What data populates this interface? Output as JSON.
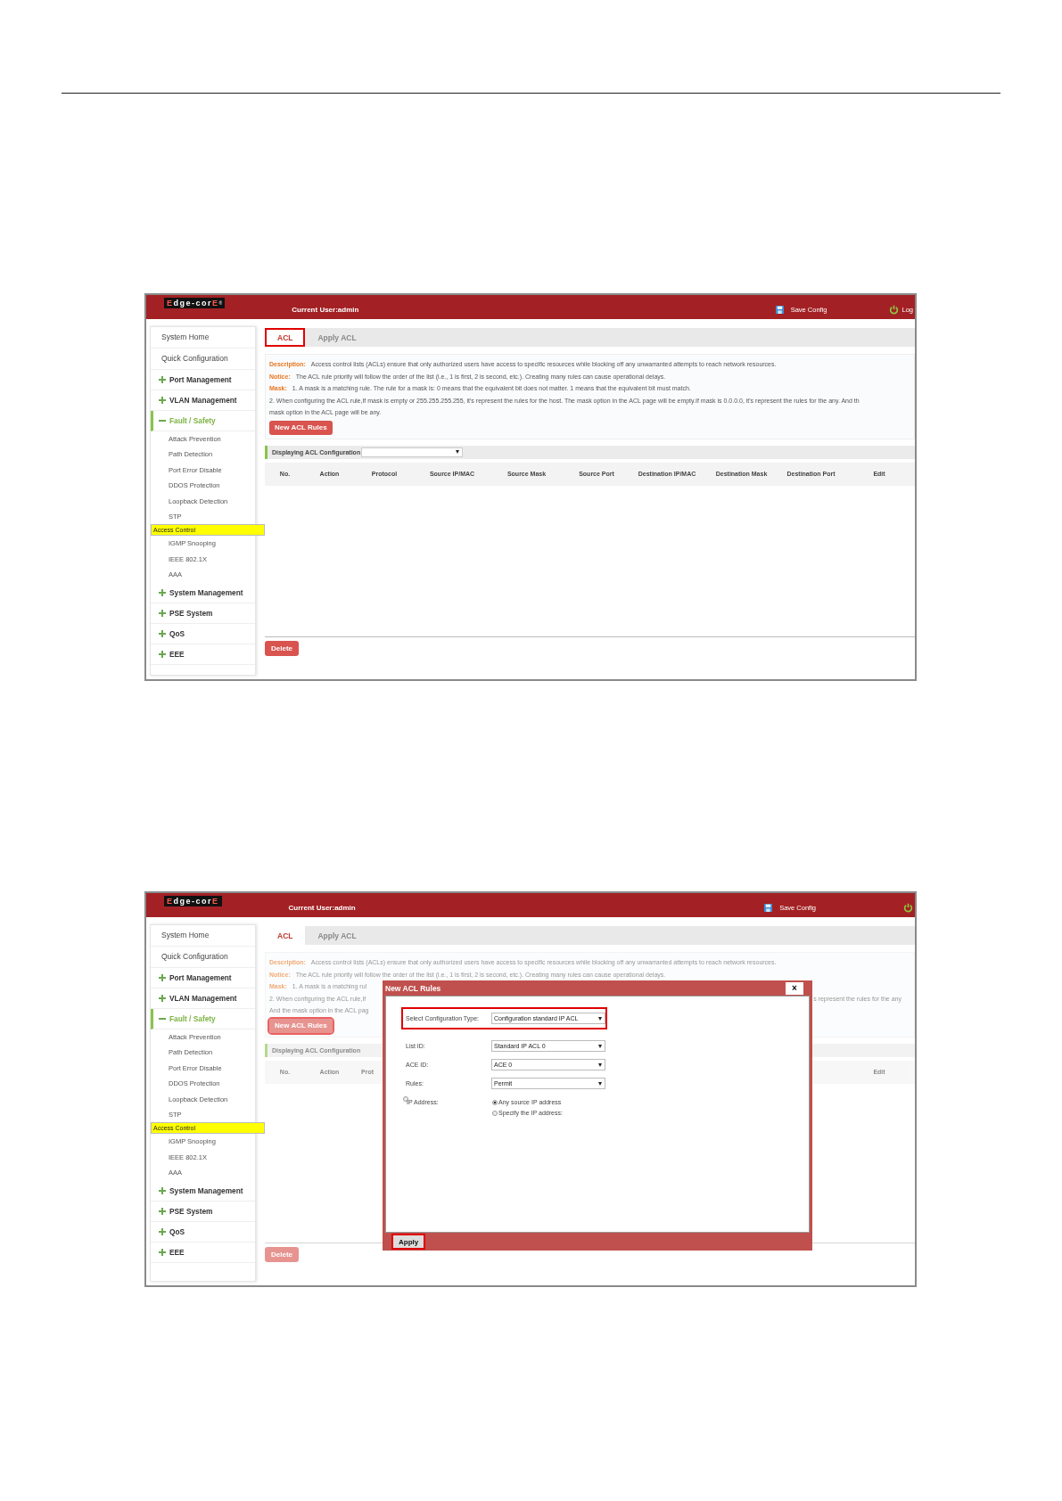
{
  "screens": [
    {
      "kind": "list",
      "header": {
        "logo": "Edge-corE",
        "logo_mark": "®",
        "user": "Current User:admin",
        "save": "Save Config",
        "logout": "Log"
      },
      "sidebar": [
        {
          "kind": "page",
          "label": "System Home"
        },
        {
          "kind": "page",
          "label": "Quick Configuration"
        },
        {
          "kind": "group",
          "label": "Port Management",
          "expanded": false
        },
        {
          "kind": "group",
          "label": "VLAN Management",
          "expanded": false
        },
        {
          "kind": "group",
          "label": "Fault / Safety",
          "expanded": true,
          "children": [
            {
              "label": "Attack Prevention",
              "selected": false
            },
            {
              "label": "Path Detection",
              "selected": false
            },
            {
              "label": "Port Error Disable",
              "selected": false
            },
            {
              "label": "DDOS Protection",
              "selected": false
            },
            {
              "label": "Loopback Detection",
              "selected": false
            },
            {
              "label": "STP",
              "selected": false
            },
            {
              "label": "Access Control",
              "selected": true
            },
            {
              "label": "IGMP Snooping",
              "selected": false
            },
            {
              "label": "IEEE 802.1X",
              "selected": false
            },
            {
              "label": "AAA",
              "selected": false
            }
          ]
        },
        {
          "kind": "group",
          "label": "System Management",
          "expanded": false
        },
        {
          "kind": "group",
          "label": "PSE System",
          "expanded": false
        },
        {
          "kind": "group",
          "label": "QoS",
          "expanded": false
        },
        {
          "kind": "group",
          "label": "EEE",
          "expanded": false
        }
      ],
      "tabs": [
        {
          "label": "ACL",
          "selected": true,
          "highlighted": true
        },
        {
          "label": "Apply ACL",
          "selected": false,
          "highlighted": false
        }
      ],
      "info": [
        {
          "label": "Description:",
          "text": "Access control lists (ACLs) ensure that only authorized users have access to specific resources while blocking off any unwarranted attempts to reach network resources."
        },
        {
          "label": "Notice:",
          "text": "The ACL rule priority will follow the order of the list (i.e., 1 is first, 2 is second, etc.). Creating many rules can cause operational delays."
        },
        {
          "label": "Mask:",
          "text": "1. A mask is a matching rule. The rule for a mask is: 0 means that the equivalent bit does not matter. 1 means that the equivalent bit must match."
        },
        {
          "text": "2. When configuring the ACL rule,If mask is empty or 255.255.255.255, it's represent the rules for the host. The mask option in the ACL page will be empty.If mask is 0.0.0.0, it's represent the rules for the any. And th"
        },
        {
          "text": "mask option in the ACL page will be any."
        }
      ],
      "new_rules": {
        "label": "New ACL Rules",
        "highlighted": false
      },
      "display": {
        "label": "Displaying ACL Configuration",
        "dropdown": true
      },
      "columns": [
        {
          "label": "No."
        },
        {
          "label": "Action"
        },
        {
          "label": "Protocol"
        },
        {
          "label": "Source IP/MAC"
        },
        {
          "label": "Source Mask"
        },
        {
          "label": "Source Port"
        },
        {
          "label": "Destination IP/MAC"
        },
        {
          "label": "Destination Mask"
        },
        {
          "label": "Destination Port"
        },
        {
          "label": "Edit",
          "kind": "edit"
        }
      ],
      "delete": "Delete"
    },
    {
      "kind": "modal",
      "header": {
        "logo": "Edge-corE",
        "user": "Current User:admin",
        "save": "Save Config"
      },
      "sidebar": [
        {
          "kind": "page",
          "label": "System Home"
        },
        {
          "kind": "page",
          "label": "Quick Configuration"
        },
        {
          "kind": "group",
          "label": "Port Management",
          "expanded": false
        },
        {
          "kind": "group",
          "label": "VLAN Management",
          "expanded": false
        },
        {
          "kind": "group",
          "label": "Fault / Safety",
          "expanded": true,
          "children": [
            {
              "label": "Attack Prevention",
              "selected": false
            },
            {
              "label": "Path Detection",
              "selected": false
            },
            {
              "label": "Port Error Disable",
              "selected": false
            },
            {
              "label": "DDOS Protection",
              "selected": false
            },
            {
              "label": "Loopback Detection",
              "selected": false
            },
            {
              "label": "STP",
              "selected": false
            },
            {
              "label": "Access Control",
              "selected": true
            },
            {
              "label": "IGMP Snooping",
              "selected": false
            },
            {
              "label": "IEEE 802.1X",
              "selected": false
            },
            {
              "label": "AAA",
              "selected": false
            }
          ]
        },
        {
          "kind": "group",
          "label": "System Management",
          "expanded": false
        },
        {
          "kind": "group",
          "label": "PSE System",
          "expanded": false
        },
        {
          "kind": "group",
          "label": "QoS",
          "expanded": false
        },
        {
          "kind": "group",
          "label": "EEE",
          "expanded": false
        }
      ],
      "tabs": [
        {
          "label": "ACL",
          "selected": true,
          "highlighted": false
        },
        {
          "label": "Apply ACL",
          "selected": false,
          "highlighted": false
        }
      ],
      "info": [
        {
          "label": "Description:",
          "text": "Access control lists (ACLs) ensure that only authorized users have access to specific resources while blocking off any unwarranted attempts to reach network resources."
        },
        {
          "label": "Notice:",
          "text": "The ACL rule priority will follow the order of the list (i.e., 1 is first, 2 is second, etc.). Creating many rules can cause operational delays."
        },
        {
          "label": "Mask:",
          "text": "1. A mask is a matching rul"
        },
        {
          "text": "2. When configuring the ACL rule,If",
          "after": "s represent the rules for the any"
        },
        {
          "text": "And the mask option in the ACL pag"
        }
      ],
      "new_rules": {
        "label": "New ACL Rules",
        "highlighted": true
      },
      "display": {
        "label": "Displaying ACL Configuration"
      },
      "columns": [
        {
          "label": "No."
        },
        {
          "label": "Action"
        },
        {
          "label": "Prot",
          "kind": "partial"
        },
        {
          "label": "Edit",
          "kind": "edit"
        }
      ],
      "delete": "Delete",
      "modal": {
        "title": "New ACL Rules",
        "close": "×",
        "fields": [
          {
            "kind": "select",
            "label": "Select Configuration Type:",
            "value": "Configuration standard IP ACL",
            "highlighted": true
          },
          {
            "kind": "select",
            "label": "List ID:",
            "value": "Standard IP ACL 0"
          },
          {
            "kind": "select",
            "label": "ACE ID:",
            "value": "ACE 0"
          },
          {
            "kind": "select",
            "label": "Rules:",
            "value": "Permit"
          },
          {
            "kind": "radio",
            "label": "IP Address:",
            "options": [
              {
                "label": "Any source IP address",
                "selected": true
              },
              {
                "label": "Specify the IP address:",
                "selected": false
              }
            ]
          }
        ],
        "apply": {
          "label": "Apply",
          "highlighted": true
        }
      }
    }
  ]
}
